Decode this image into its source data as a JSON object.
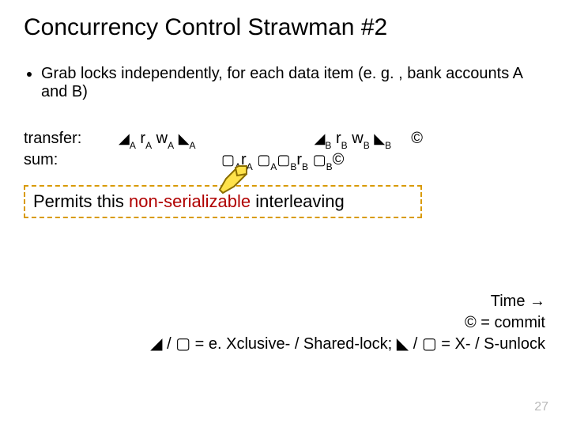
{
  "title": "Concurrency Control Strawman #2",
  "bullet1": "Grab locks independently, for each data item (e. g. , bank accounts A and B)",
  "labels": {
    "transfer": "transfer:",
    "sum": "sum:"
  },
  "sym": {
    "lock": "◢",
    "unlock": "◣",
    "slock": "▢",
    "commit": "©"
  },
  "sub": {
    "A": "A",
    "B": "B"
  },
  "ops": {
    "rA": "r",
    "wA": "w",
    "rB": "r",
    "wB": "w"
  },
  "callout": {
    "prefix": "Permits ",
    "mid": "this ",
    "hl": "non-serializable",
    "suffix": " interleaving"
  },
  "legend": {
    "l1": "Time →",
    "l2_pre": "© = ",
    "l2_post": "commit",
    "l3": "◢ / ▢ = e. Xclusive- / Shared-lock;  ◣ / ▢ = X- / S-unlock"
  },
  "page": "27"
}
